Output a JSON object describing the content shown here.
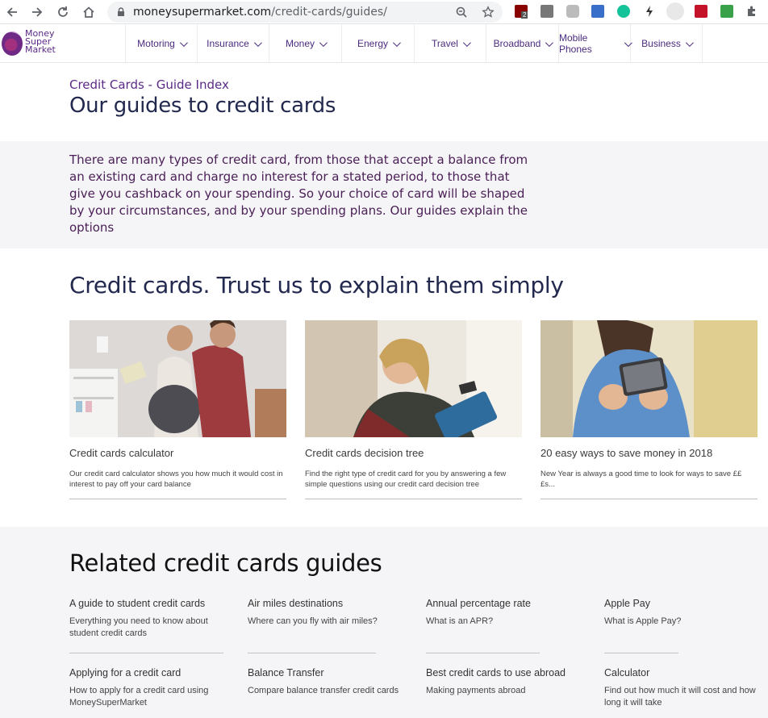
{
  "browser": {
    "url_domain": "moneysupermarket.com",
    "url_path": "/credit-cards/guides/",
    "extension_badge": "2",
    "extensions": [
      "ublock-icon",
      "css-icon",
      "camera-icon",
      "calendar-icon",
      "grammarly-icon",
      "bolt-icon",
      "profile-icon",
      "pdf-icon",
      "download-icon",
      "puzzle-icon"
    ]
  },
  "logo": {
    "line1": "Money",
    "line2": "Super",
    "line3": "Market"
  },
  "nav": [
    {
      "label": "Motoring"
    },
    {
      "label": "Insurance"
    },
    {
      "label": "Money"
    },
    {
      "label": "Energy"
    },
    {
      "label": "Travel"
    },
    {
      "label": "Broadband"
    },
    {
      "label": "Mobile Phones"
    },
    {
      "label": "Business"
    }
  ],
  "page": {
    "breadcrumb": "Credit Cards - Guide Index",
    "title": "Our guides to credit cards",
    "intro": "There are many types of credit card, from those that accept a balance from an existing card and charge no interest for a stated period, to those that give you cashback on your spending. So your choice of card will be shaped by your circumstances, and by your spending plans. Our guides explain the options",
    "section_title": "Credit cards. Trust us to explain them simply"
  },
  "cards": [
    {
      "title": "Credit cards calculator",
      "desc": "Our credit card calculator shows you how much it would cost in interest to pay off your card balance"
    },
    {
      "title": "Credit cards decision tree",
      "desc": "Find the right type of credit card for you by answering a few simple questions using our credit card decision tree"
    },
    {
      "title": "20 easy ways to save money in 2018",
      "desc": "New Year is always a good time to look for ways to save ££ £s..."
    }
  ],
  "related": {
    "title": "Related credit cards guides",
    "guides": [
      {
        "title": "A guide to student credit cards",
        "desc": "Everything you need to know about student credit cards"
      },
      {
        "title": "Air miles destinations",
        "desc": "Where can you fly with air miles?"
      },
      {
        "title": "Annual percentage rate",
        "desc": "What is an APR?"
      },
      {
        "title": "Apple Pay",
        "desc": "What is Apple Pay?"
      },
      {
        "title": "Applying for a credit card",
        "desc": "How to apply for a credit card using MoneySuperMarket"
      },
      {
        "title": "Balance Transfer",
        "desc": "Compare balance transfer credit cards"
      },
      {
        "title": "Best credit cards to use abroad",
        "desc": "Making payments abroad"
      },
      {
        "title": "Calculator",
        "desc": "Find out how much it will cost and how long it will take"
      }
    ]
  },
  "colors": {
    "brand_purple": "#5b2a86",
    "title_navy": "#22284e",
    "band_grey": "#f5f5f7"
  }
}
